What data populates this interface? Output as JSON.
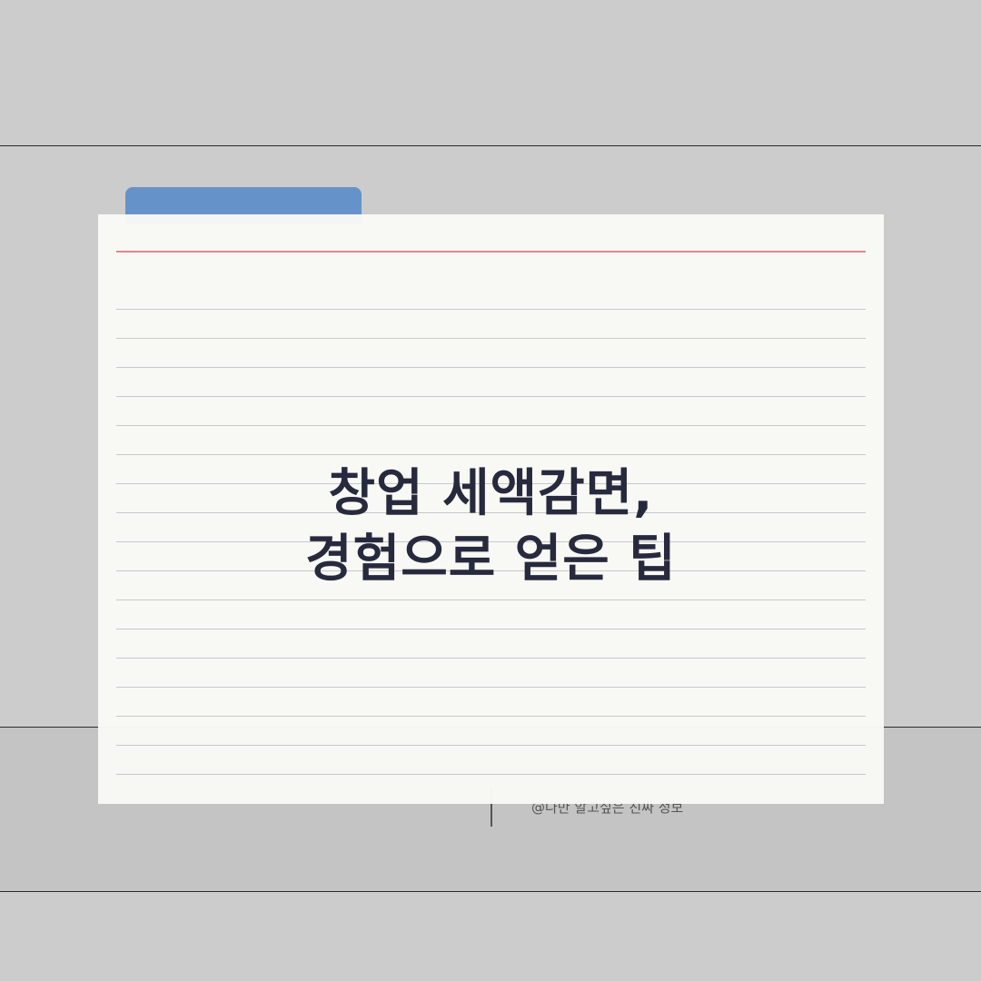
{
  "title": {
    "line1": "창업 세액감면,",
    "line2": "경험으로 얻은 팁"
  },
  "footer": {
    "text": "@나만 알고싶은 진짜 정보"
  },
  "colors": {
    "background": "#cccccc",
    "bottom_band": "#c4c4c4",
    "folder_tab": "#6593c9",
    "card": "#f9f9f6",
    "margin_line": "#d98b8b",
    "ruled_line": "#c8c8c8",
    "title_text": "#272a3d"
  }
}
